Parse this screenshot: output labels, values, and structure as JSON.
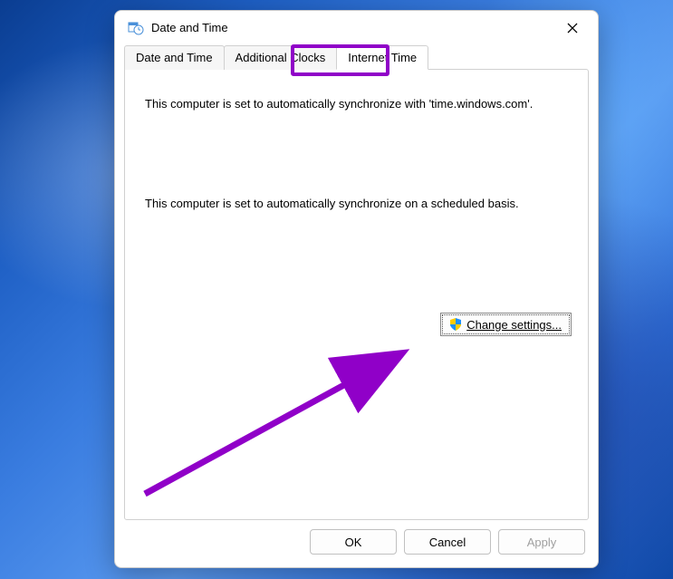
{
  "dialog": {
    "title": "Date and Time",
    "tabs": [
      {
        "label": "Date and Time",
        "active": false
      },
      {
        "label": "Additional Clocks",
        "active": false
      },
      {
        "label": "Internet Time",
        "active": true
      }
    ],
    "sync_status_text": "This computer is set to automatically synchronize with 'time.windows.com'.",
    "schedule_text": "This computer is set to automatically synchronize on a scheduled basis.",
    "change_settings_label": "Change settings...",
    "buttons": {
      "ok": "OK",
      "cancel": "Cancel",
      "apply": "Apply"
    }
  },
  "annotations": {
    "highlight_color": "#9000c8",
    "highlighted_tab_index": 2,
    "arrow_target": "change-settings-button"
  }
}
